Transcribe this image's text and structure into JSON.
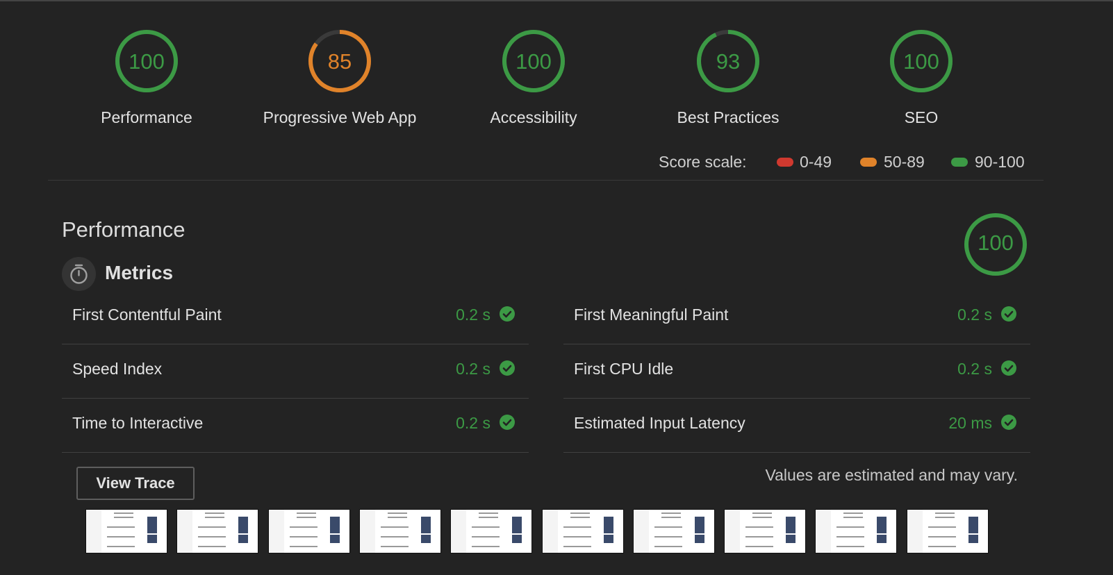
{
  "gauges": [
    {
      "score": "100",
      "label": "Performance",
      "color": "#3c9a45",
      "fraction": 1.0
    },
    {
      "score": "85",
      "label": "Progressive Web App",
      "color": "#e0832a",
      "fraction": 0.85
    },
    {
      "score": "100",
      "label": "Accessibility",
      "color": "#3c9a45",
      "fraction": 1.0
    },
    {
      "score": "93",
      "label": "Best Practices",
      "color": "#3c9a45",
      "fraction": 0.93
    },
    {
      "score": "100",
      "label": "SEO",
      "color": "#3c9a45",
      "fraction": 1.0
    }
  ],
  "score_scale": {
    "label": "Score scale:",
    "ranges": [
      {
        "text": "0-49",
        "color": "#d0392f"
      },
      {
        "text": "50-89",
        "color": "#e0832a"
      },
      {
        "text": "90-100",
        "color": "#3c9a45"
      }
    ]
  },
  "performance": {
    "title": "Performance",
    "score": "100",
    "metrics_title": "Metrics",
    "metrics": [
      {
        "label": "First Contentful Paint",
        "value": "0.2 s"
      },
      {
        "label": "First Meaningful Paint",
        "value": "0.2 s"
      },
      {
        "label": "Speed Index",
        "value": "0.2 s"
      },
      {
        "label": "First CPU Idle",
        "value": "0.2 s"
      },
      {
        "label": "Time to Interactive",
        "value": "0.2 s"
      },
      {
        "label": "Estimated Input Latency",
        "value": "20 ms"
      }
    ],
    "view_trace_label": "View Trace",
    "estimate_note": "Values are estimated and may vary."
  },
  "colors": {
    "pass": "#3c9a45",
    "average": "#e0832a",
    "fail": "#d0392f",
    "background": "#232323"
  },
  "icons": {
    "metrics": "timer-icon",
    "pass": "check-circle-icon"
  }
}
